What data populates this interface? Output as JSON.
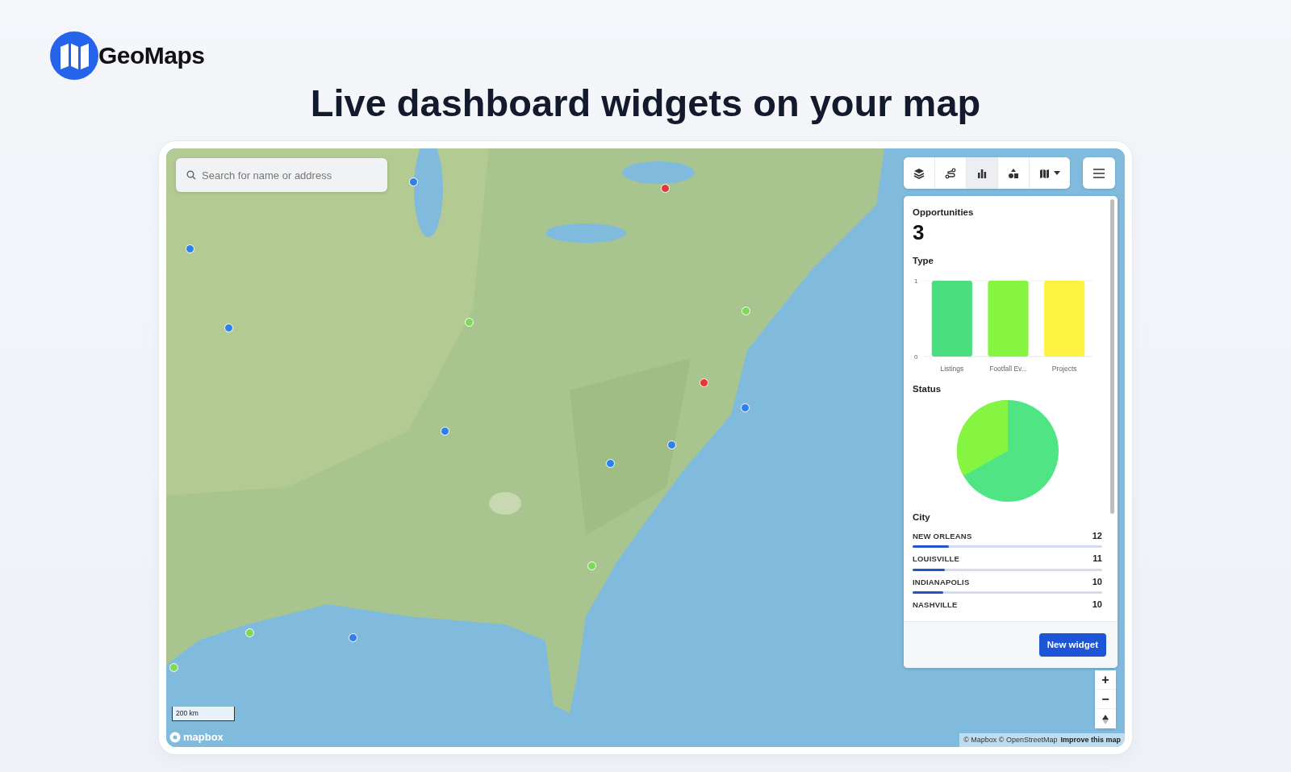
{
  "brand": {
    "name": "GeoMaps"
  },
  "headline": "Live dashboard widgets on your map",
  "map": {
    "kind": "picture",
    "search": {
      "placeholder": "Search for name or address"
    },
    "toolbar": [
      {
        "kind": "layers",
        "selected": false
      },
      {
        "kind": "route",
        "selected": false
      },
      {
        "kind": "chart",
        "selected": true
      },
      {
        "kind": "shapes",
        "selected": false
      },
      {
        "kind": "basemap",
        "selected": false
      }
    ],
    "panel": {
      "metric": {
        "title": "Opportunities",
        "value": "3"
      },
      "type_widget": {
        "title": "Type",
        "chart_data": {
          "type": "bar",
          "categories": [
            "Listings",
            "Footfall Ev...",
            "Projects"
          ],
          "series": [
            {
              "values": [
                1,
                1,
                1
              ]
            }
          ],
          "colors": [
            "#4ade80",
            "#86f542",
            "#fdf23f"
          ],
          "yticks": [
            0,
            1
          ],
          "ylim": [
            0,
            1
          ]
        }
      },
      "status_widget": {
        "title": "Status"
      },
      "city_widget": {
        "title": "City",
        "rows": [
          {
            "name": "NEW ORLEANS",
            "count": "12",
            "level": 0.19
          },
          {
            "name": "LOUISVILLE",
            "count": "11",
            "level": 0.17
          },
          {
            "name": "INDIANAPOLIS",
            "count": "10",
            "level": 0.16
          },
          {
            "name": "NASHVILLE",
            "count": "10"
          }
        ]
      },
      "new_widget_button": "New widget"
    },
    "markers": [
      {
        "color": "#e53935"
      },
      {
        "color": "#e53935"
      },
      {
        "color": "#2f80ed"
      },
      {
        "color": "#2f80ed"
      },
      {
        "color": "#2f80ed"
      },
      {
        "color": "#7ed957"
      },
      {
        "color": "#2f80ed"
      },
      {
        "color": "#2f80ed"
      },
      {
        "color": "#7ed957"
      },
      {
        "color": "#2f80ed"
      },
      {
        "color": "#7ed957"
      },
      {
        "color": "#2f80ed"
      },
      {
        "color": "#7ed957"
      },
      {
        "color": "#2f80ed"
      },
      {
        "color": "#7ed957"
      }
    ],
    "zoom": {
      "in": "+",
      "out": "−"
    },
    "scale": "200 km",
    "logo": "mapbox",
    "attribution": {
      "text": "© Mapbox © OpenStreetMap",
      "link": "Improve this map"
    }
  }
}
